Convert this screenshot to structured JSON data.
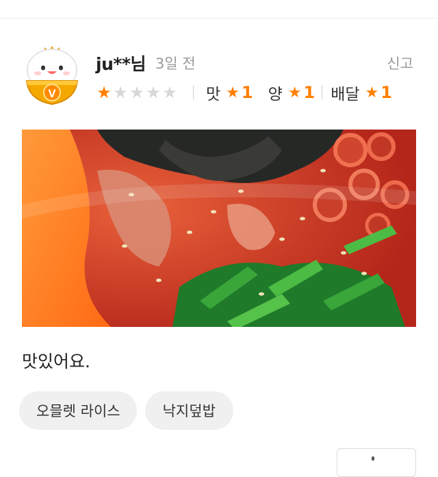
{
  "review": {
    "username": "ju**님",
    "time_ago": "3일 전",
    "report_label": "신고",
    "rating": 1,
    "max_rating": 5,
    "star_glyph": "★",
    "sub_ratings": [
      {
        "label": "맛",
        "value": "1"
      },
      {
        "label": "양",
        "value": "1"
      },
      {
        "label": "배달",
        "value": "1"
      }
    ],
    "avatar": {
      "badge_letter": "V"
    },
    "photo_icon": "food-photo",
    "text": "맛있어요.",
    "menu_tags": [
      "오믈렛 라이스",
      "낙지덮밥"
    ]
  },
  "colors": {
    "accent": "#ff7f00",
    "star_off": "#d7d7d7",
    "muted_text": "#9a9a9a",
    "tag_bg": "#f0f0f0"
  }
}
